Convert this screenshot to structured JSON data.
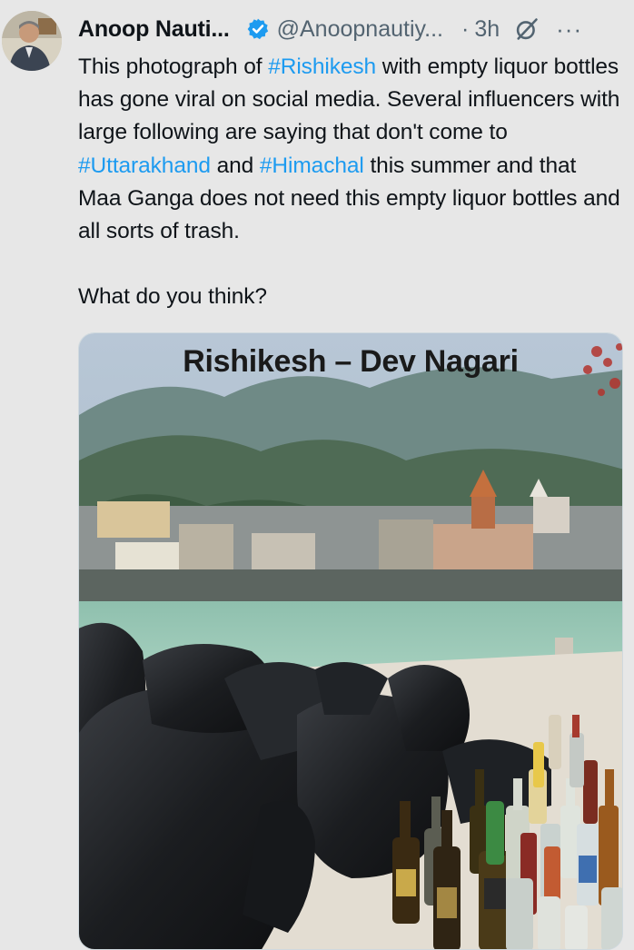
{
  "tweet": {
    "author_name": "Anoop Nauti...",
    "handle": "@Anoopnautiy...",
    "separator": "·",
    "timestamp": "3h",
    "more_glyph": "···",
    "paragraphs": [
      [
        {
          "text": "This photograph of ",
          "type": "text"
        },
        {
          "text": "#Rishikesh",
          "type": "hashtag"
        },
        {
          "text": " with empty liquor bottles has gone viral on social media. Several influencers with large following are saying that don't come to ",
          "type": "text"
        },
        {
          "text": "#Uttarakhand",
          "type": "hashtag"
        },
        {
          "text": " and ",
          "type": "text"
        },
        {
          "text": "#Himachal",
          "type": "hashtag"
        },
        {
          "text": " this summer and that Maa Ganga does not need this empty liquor bottles and all sorts of trash.",
          "type": "text"
        }
      ],
      [
        {
          "text": "What do you think?",
          "type": "text"
        }
      ]
    ],
    "media": {
      "caption_overlay": "Rishikesh – Dev Nagari"
    }
  },
  "colors": {
    "background": "#e7e7e7",
    "text": "#0f1419",
    "secondary_text": "#536471",
    "hashtag": "#1d9bf0",
    "verified_badge": "#1d9bf0"
  },
  "icons": [
    "avatar",
    "verified-badge-icon",
    "grok-icon",
    "more-icon"
  ]
}
